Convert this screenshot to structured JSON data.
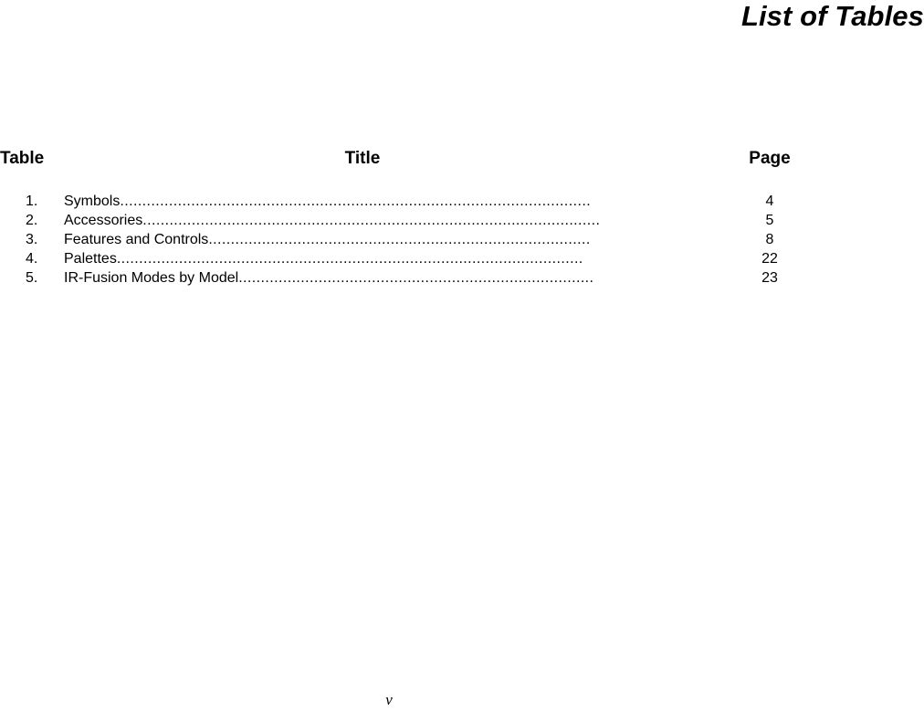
{
  "document": {
    "heading": "List of Tables",
    "footer_page_number": "v"
  },
  "columns": {
    "table": "Table",
    "title": "Title",
    "page": "Page"
  },
  "entries": [
    {
      "index": "1.",
      "title": "Symbols",
      "leader": "..........................................................................................................",
      "page": "4"
    },
    {
      "index": "2.",
      "title": "Accessories ",
      "leader": ".......................................................................................................",
      "page": "5"
    },
    {
      "index": "3.",
      "title": "Features and Controls ",
      "leader": "......................................................................................",
      "page": "8"
    },
    {
      "index": "4.",
      "title": "Palettes",
      "leader": ".........................................................................................................",
      "page": "22"
    },
    {
      "index": "5.",
      "title": "IR-Fusion Modes by Model ",
      "leader": "................................................................................",
      "page": "23"
    }
  ]
}
